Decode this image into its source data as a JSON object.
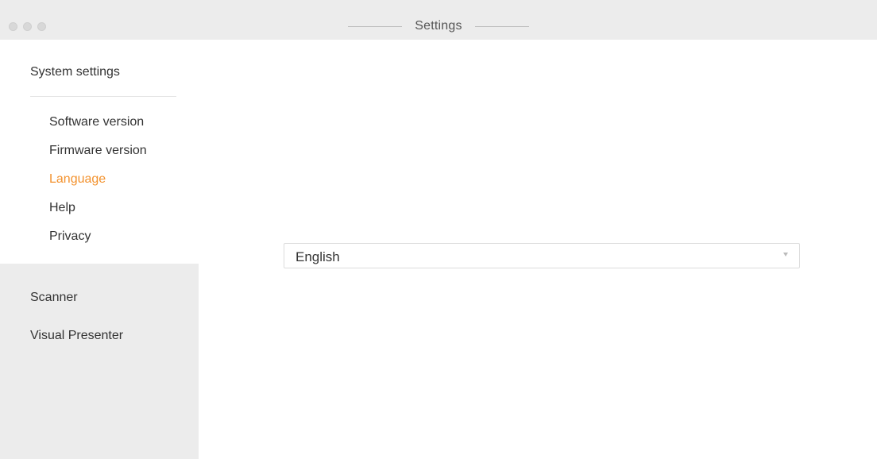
{
  "window": {
    "title": "Settings"
  },
  "sidebar": {
    "system_settings": {
      "title": "System settings",
      "items": [
        {
          "label": "Software version",
          "active": false
        },
        {
          "label": "Firmware version",
          "active": false
        },
        {
          "label": "Language",
          "active": true
        },
        {
          "label": "Help",
          "active": false
        },
        {
          "label": "Privacy",
          "active": false
        }
      ]
    },
    "scanner": {
      "title": "Scanner"
    },
    "visual_presenter": {
      "title": "Visual Presenter"
    }
  },
  "main": {
    "language_select": {
      "value": "English"
    }
  },
  "colors": {
    "accent": "#f3922e",
    "titlebar_bg": "#ececec",
    "sidebar_inactive_bg": "#ececec",
    "text": "#333333"
  },
  "icons": {
    "traffic_lights": [
      "close-button-icon",
      "minimize-button-icon",
      "zoom-button-icon"
    ],
    "dropdown": "chevron-down-icon"
  }
}
